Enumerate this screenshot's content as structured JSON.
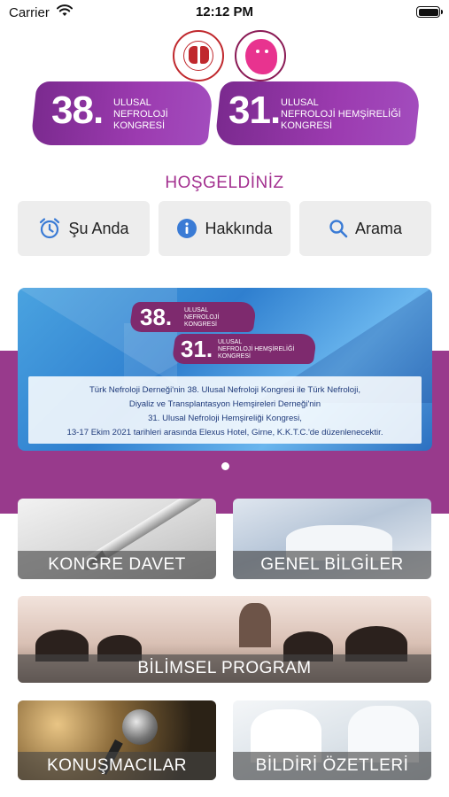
{
  "status_bar": {
    "carrier": "Carrier",
    "time": "12:12 PM"
  },
  "banner": {
    "left": {
      "number": "38.",
      "line1": "ULUSAL",
      "line2": "NEFROLOJİ",
      "line3": "KONGRESİ"
    },
    "right": {
      "number": "31.",
      "line1": "ULUSAL",
      "line2": "NEFROLOJİ HEMŞİRELİĞİ",
      "line3": "KONGRESİ"
    }
  },
  "welcome": "HOŞGELDİNİZ",
  "actions": [
    {
      "label": "Şu Anda",
      "icon": "alarm-clock-icon"
    },
    {
      "label": "Hakkında",
      "icon": "info-icon"
    },
    {
      "label": "Arama",
      "icon": "search-icon"
    }
  ],
  "slider": {
    "badge1": {
      "number": "38.",
      "line1": "ULUSAL",
      "line2": "NEFROLOJİ",
      "line3": "KONGRESİ"
    },
    "badge2": {
      "number": "31.",
      "line1": "ULUSAL",
      "line2": "NEFROLOJİ HEMŞİRELİĞİ",
      "line3": "KONGRESİ"
    },
    "text_lines": [
      "Türk Nefroloji Derneği'nin 38. Ulusal Nefroloji Kongresi ile Türk Nefroloji,",
      "Diyaliz ve Transplantasyon Hemşireleri Derneği'nin",
      "31. Ulusal Nefroloji Hemşireliği Kongresi,",
      "13-17 Ekim 2021 tarihleri arasında Elexus Hotel, Girne, K.K.T.C.'de düzenlenecektir."
    ]
  },
  "menu": {
    "invite": "KONGRE DAVET",
    "general": "GENEL BİLGİLER",
    "program": "BİLİMSEL PROGRAM",
    "speakers": "KONUŞMACILAR",
    "abstracts": "BİLDİRİ ÖZETLERİ"
  },
  "colors": {
    "brand_purple": "#983a8c",
    "welcome_text": "#a3308f",
    "icon_blue": "#3a7bd5"
  }
}
